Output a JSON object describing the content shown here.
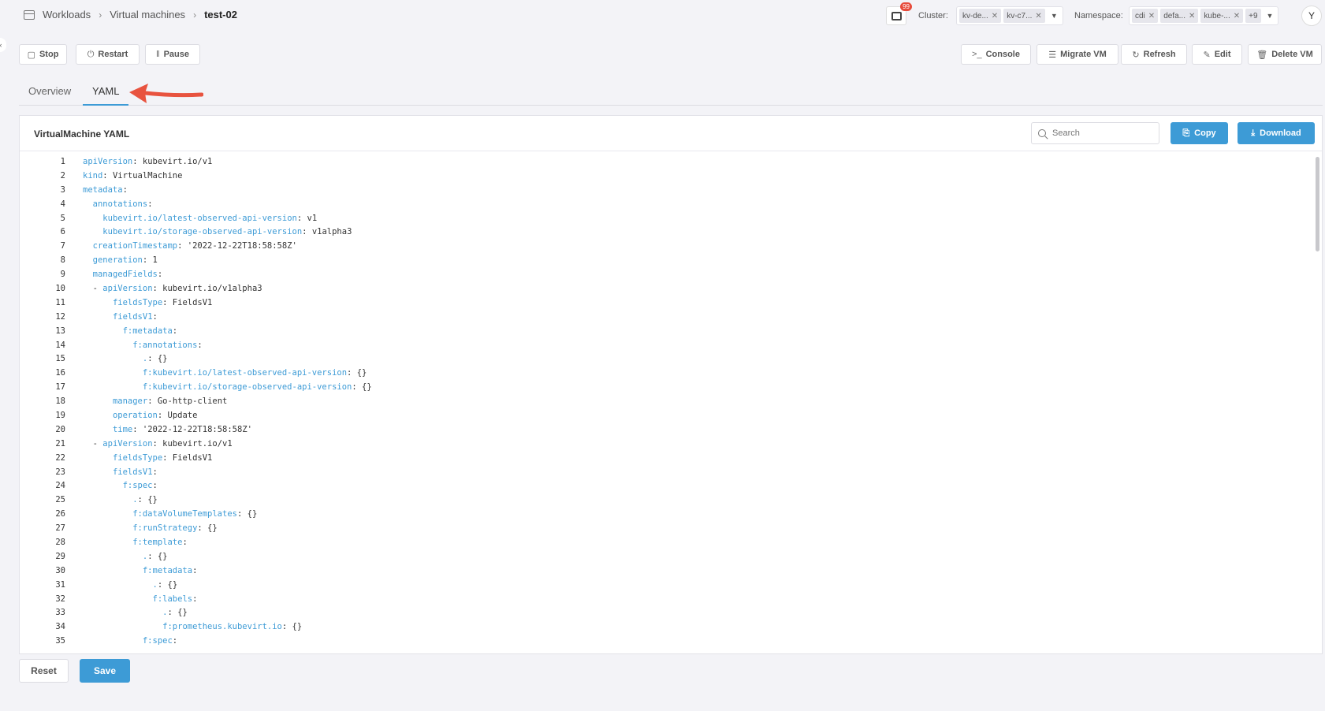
{
  "breadcrumb": {
    "items": [
      "Workloads",
      "Virtual machines",
      "test-02"
    ]
  },
  "notifications": {
    "badge": "99"
  },
  "cluster": {
    "label": "Cluster:",
    "chips": [
      "kv-de...",
      "kv-c7..."
    ]
  },
  "namespace": {
    "label": "Namespace:",
    "chips": [
      "cdi",
      "defa...",
      "kube-..."
    ],
    "more": "+9"
  },
  "user": {
    "initial": "Y"
  },
  "actions_left": [
    "Stop",
    "Restart",
    "Pause"
  ],
  "actions_right": [
    "Console",
    "Migrate VM",
    "Refresh",
    "Edit",
    "Delete VM"
  ],
  "tabs": [
    "Overview",
    "YAML"
  ],
  "active_tab": "YAML",
  "panel": {
    "title": "VirtualMachine YAML",
    "search_placeholder": "Search",
    "copy_label": "Copy",
    "download_label": "Download"
  },
  "yaml_lines": [
    {
      "n": "1",
      "indent": 0,
      "key": "apiVersion",
      "val": " kubevirt.io/v1"
    },
    {
      "n": "2",
      "indent": 0,
      "key": "kind",
      "val": " VirtualMachine"
    },
    {
      "n": "3",
      "indent": 0,
      "key": "metadata",
      "val": ""
    },
    {
      "n": "4",
      "indent": 1,
      "key": "annotations",
      "val": ""
    },
    {
      "n": "5",
      "indent": 2,
      "key": "kubevirt.io/latest-observed-api-version",
      "val": " v1"
    },
    {
      "n": "6",
      "indent": 2,
      "key": "kubevirt.io/storage-observed-api-version",
      "val": " v1alpha3"
    },
    {
      "n": "7",
      "indent": 1,
      "key": "creationTimestamp",
      "val": " '2022-12-22T18:58:58Z'"
    },
    {
      "n": "8",
      "indent": 1,
      "key": "generation",
      "val": " 1"
    },
    {
      "n": "9",
      "indent": 1,
      "key": "managedFields",
      "val": ""
    },
    {
      "n": "10",
      "indent": 2,
      "dash": true,
      "key": "apiVersion",
      "val": " kubevirt.io/v1alpha3"
    },
    {
      "n": "11",
      "indent": 3,
      "key": "fieldsType",
      "val": " FieldsV1"
    },
    {
      "n": "12",
      "indent": 3,
      "key": "fieldsV1",
      "val": ""
    },
    {
      "n": "13",
      "indent": 4,
      "key": "f:metadata",
      "val": ""
    },
    {
      "n": "14",
      "indent": 5,
      "key": "f:annotations",
      "val": ""
    },
    {
      "n": "15",
      "indent": 6,
      "key": ".",
      "val": " {}"
    },
    {
      "n": "16",
      "indent": 6,
      "key": "f:kubevirt.io/latest-observed-api-version",
      "val": " {}"
    },
    {
      "n": "17",
      "indent": 6,
      "key": "f:kubevirt.io/storage-observed-api-version",
      "val": " {}"
    },
    {
      "n": "18",
      "indent": 3,
      "key": "manager",
      "val": " Go-http-client"
    },
    {
      "n": "19",
      "indent": 3,
      "key": "operation",
      "val": " Update"
    },
    {
      "n": "20",
      "indent": 3,
      "key": "time",
      "val": " '2022-12-22T18:58:58Z'"
    },
    {
      "n": "21",
      "indent": 2,
      "dash": true,
      "key": "apiVersion",
      "val": " kubevirt.io/v1"
    },
    {
      "n": "22",
      "indent": 3,
      "key": "fieldsType",
      "val": " FieldsV1"
    },
    {
      "n": "23",
      "indent": 3,
      "key": "fieldsV1",
      "val": ""
    },
    {
      "n": "24",
      "indent": 4,
      "key": "f:spec",
      "val": ""
    },
    {
      "n": "25",
      "indent": 5,
      "key": ".",
      "val": " {}"
    },
    {
      "n": "26",
      "indent": 5,
      "key": "f:dataVolumeTemplates",
      "val": " {}"
    },
    {
      "n": "27",
      "indent": 5,
      "key": "f:runStrategy",
      "val": " {}"
    },
    {
      "n": "28",
      "indent": 5,
      "key": "f:template",
      "val": ""
    },
    {
      "n": "29",
      "indent": 6,
      "key": ".",
      "val": " {}"
    },
    {
      "n": "30",
      "indent": 6,
      "key": "f:metadata",
      "val": ""
    },
    {
      "n": "31",
      "indent": 7,
      "key": ".",
      "val": " {}"
    },
    {
      "n": "32",
      "indent": 7,
      "key": "f:labels",
      "val": ""
    },
    {
      "n": "33",
      "indent": 8,
      "key": ".",
      "val": " {}"
    },
    {
      "n": "34",
      "indent": 8,
      "key": "f:prometheus.kubevirt.io",
      "val": " {}"
    },
    {
      "n": "35",
      "indent": 6,
      "key": "f:spec",
      "val": ""
    }
  ],
  "footer": {
    "reset_label": "Reset",
    "save_label": "Save"
  },
  "colors": {
    "accent": "#3d9bd6",
    "annotation_arrow": "#e8533f"
  }
}
